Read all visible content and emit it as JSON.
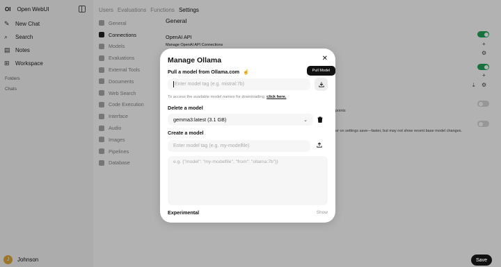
{
  "sidebar": {
    "logo": "OI",
    "app_name": "Open WebUI",
    "nav": [
      {
        "label": "New Chat",
        "icon": "pencil-icon"
      },
      {
        "label": "Search",
        "icon": "search-icon"
      },
      {
        "label": "Notes",
        "icon": "notes-icon"
      },
      {
        "label": "Workspace",
        "icon": "grid-icon"
      }
    ],
    "folders_label": "Folders",
    "chats_label": "Chats",
    "user": {
      "initial": "J",
      "name": "Johnson"
    }
  },
  "tabs": [
    "Users",
    "Evaluations",
    "Functions",
    "Settings"
  ],
  "settings_nav": [
    "General",
    "Connections",
    "Models",
    "Evaluations",
    "External Tools",
    "Documents",
    "Web Search",
    "Code Execution",
    "Interface",
    "Audio",
    "Images",
    "Pipelines",
    "Database"
  ],
  "content": {
    "title": "General",
    "openai_api": "OpenAI API",
    "openai_desc": "Manage OpenAI API Connections",
    "fragment_points": "points",
    "fragment_save": "or on settings save—faster, but may not show recent base model changes."
  },
  "modal": {
    "title": "Manage Ollama",
    "close": "✕",
    "pull_label": "Pull a model from Ollama.com",
    "pull_placeholder": "Enter model tag (e.g. mistral:7b)",
    "tooltip": "Pull Model",
    "hint_text": "To access the available model names for downloading, ",
    "hint_link": "click here.",
    "delete_label": "Delete a model",
    "delete_selected": "gemma3:latest (3.1 GB)",
    "create_label": "Create a model",
    "create_placeholder": "Enter model tag (e.g. my-modelfile)",
    "modelfile_placeholder": "e.g. {\"model\": \"my-modelfile\", \"from\": \"ollama:7b\"})",
    "experimental_label": "Experimental",
    "show_label": "Show"
  },
  "save_label": "Save",
  "colors": {
    "toggle_on": "#22a558",
    "avatar": "#e2a93b",
    "overlay": "rgba(0,0,0,0.3)"
  }
}
